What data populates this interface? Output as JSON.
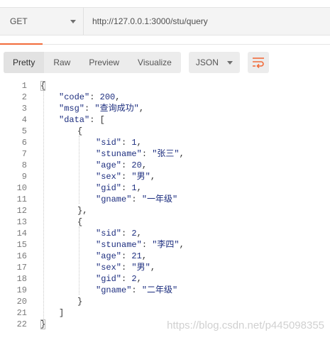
{
  "request": {
    "method": "GET",
    "url": "http://127.0.0.1:3000/stu/query"
  },
  "response_toolbar": {
    "tabs": [
      "Pretty",
      "Raw",
      "Preview",
      "Visualize"
    ],
    "active_tab": "Pretty",
    "format": "JSON",
    "wrap_icon": "wrap-lines-icon",
    "accent_color": "#f26b3a"
  },
  "code_lines": [
    {
      "n": "1",
      "indent": 0,
      "tokens": [
        [
          "punc",
          "{"
        ]
      ]
    },
    {
      "n": "2",
      "indent": 1,
      "tokens": [
        [
          "key",
          "\"code\""
        ],
        [
          "punc",
          ": "
        ],
        [
          "num",
          "200"
        ],
        [
          "punc",
          ","
        ]
      ]
    },
    {
      "n": "3",
      "indent": 1,
      "tokens": [
        [
          "key",
          "\"msg\""
        ],
        [
          "punc",
          ": "
        ],
        [
          "str",
          "\"查询成功\""
        ],
        [
          "punc",
          ","
        ]
      ]
    },
    {
      "n": "4",
      "indent": 1,
      "tokens": [
        [
          "key",
          "\"data\""
        ],
        [
          "punc",
          ": ["
        ]
      ]
    },
    {
      "n": "5",
      "indent": 2,
      "tokens": [
        [
          "punc",
          "{"
        ]
      ]
    },
    {
      "n": "6",
      "indent": 3,
      "tokens": [
        [
          "key",
          "\"sid\""
        ],
        [
          "punc",
          ": "
        ],
        [
          "num",
          "1"
        ],
        [
          "punc",
          ","
        ]
      ]
    },
    {
      "n": "7",
      "indent": 3,
      "tokens": [
        [
          "key",
          "\"stuname\""
        ],
        [
          "punc",
          ": "
        ],
        [
          "str",
          "\"张三\""
        ],
        [
          "punc",
          ","
        ]
      ]
    },
    {
      "n": "8",
      "indent": 3,
      "tokens": [
        [
          "key",
          "\"age\""
        ],
        [
          "punc",
          ": "
        ],
        [
          "num",
          "20"
        ],
        [
          "punc",
          ","
        ]
      ]
    },
    {
      "n": "9",
      "indent": 3,
      "tokens": [
        [
          "key",
          "\"sex\""
        ],
        [
          "punc",
          ": "
        ],
        [
          "str",
          "\"男\""
        ],
        [
          "punc",
          ","
        ]
      ]
    },
    {
      "n": "10",
      "indent": 3,
      "tokens": [
        [
          "key",
          "\"gid\""
        ],
        [
          "punc",
          ": "
        ],
        [
          "num",
          "1"
        ],
        [
          "punc",
          ","
        ]
      ]
    },
    {
      "n": "11",
      "indent": 3,
      "tokens": [
        [
          "key",
          "\"gname\""
        ],
        [
          "punc",
          ": "
        ],
        [
          "str",
          "\"一年级\""
        ]
      ]
    },
    {
      "n": "12",
      "indent": 2,
      "tokens": [
        [
          "punc",
          "},"
        ]
      ]
    },
    {
      "n": "13",
      "indent": 2,
      "tokens": [
        [
          "punc",
          "{"
        ]
      ]
    },
    {
      "n": "14",
      "indent": 3,
      "tokens": [
        [
          "key",
          "\"sid\""
        ],
        [
          "punc",
          ": "
        ],
        [
          "num",
          "2"
        ],
        [
          "punc",
          ","
        ]
      ]
    },
    {
      "n": "15",
      "indent": 3,
      "tokens": [
        [
          "key",
          "\"stuname\""
        ],
        [
          "punc",
          ": "
        ],
        [
          "str",
          "\"李四\""
        ],
        [
          "punc",
          ","
        ]
      ]
    },
    {
      "n": "16",
      "indent": 3,
      "tokens": [
        [
          "key",
          "\"age\""
        ],
        [
          "punc",
          ": "
        ],
        [
          "num",
          "21"
        ],
        [
          "punc",
          ","
        ]
      ]
    },
    {
      "n": "17",
      "indent": 3,
      "tokens": [
        [
          "key",
          "\"sex\""
        ],
        [
          "punc",
          ": "
        ],
        [
          "str",
          "\"男\""
        ],
        [
          "punc",
          ","
        ]
      ]
    },
    {
      "n": "18",
      "indent": 3,
      "tokens": [
        [
          "key",
          "\"gid\""
        ],
        [
          "punc",
          ": "
        ],
        [
          "num",
          "2"
        ],
        [
          "punc",
          ","
        ]
      ]
    },
    {
      "n": "19",
      "indent": 3,
      "tokens": [
        [
          "key",
          "\"gname\""
        ],
        [
          "punc",
          ": "
        ],
        [
          "str",
          "\"二年级\""
        ]
      ]
    },
    {
      "n": "20",
      "indent": 2,
      "tokens": [
        [
          "punc",
          "}"
        ]
      ]
    },
    {
      "n": "21",
      "indent": 1,
      "tokens": [
        [
          "punc",
          "]"
        ]
      ]
    },
    {
      "n": "22",
      "indent": 0,
      "tokens": [
        [
          "punc",
          "}"
        ]
      ]
    }
  ],
  "watermark": "https://blog.csdn.net/p445098355"
}
